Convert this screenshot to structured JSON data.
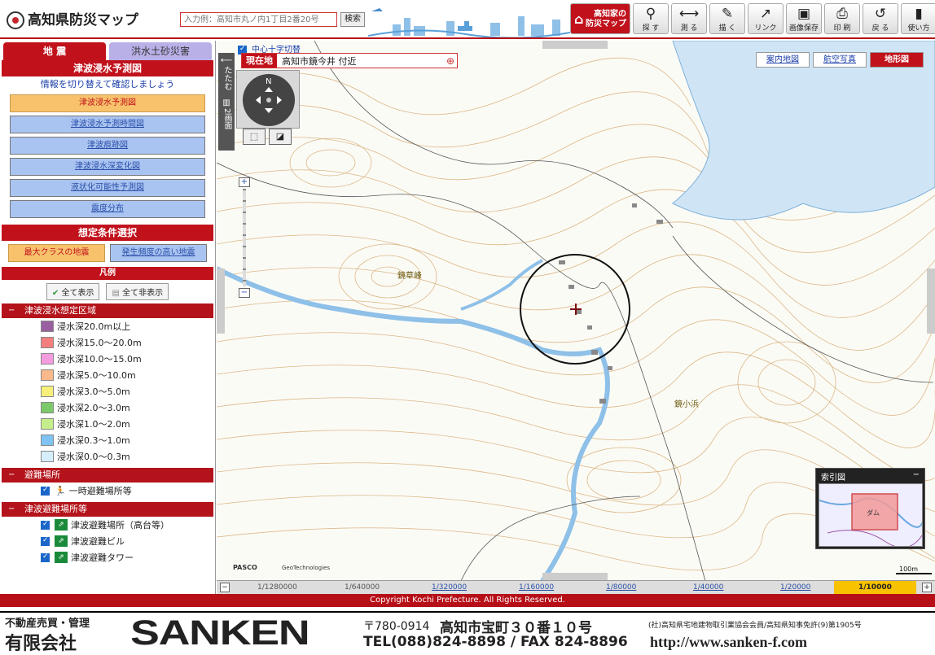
{
  "header": {
    "title": "高知県防災マップ",
    "search_placeholder": "入力例：高知市丸ノ内1丁目2番20号",
    "search_button": "検索"
  },
  "toolbar": [
    {
      "label": "高知家の\n防災マップ",
      "icon": "home-icon"
    },
    {
      "label": "探 す",
      "icon": "magnifier-icon"
    },
    {
      "label": "測 る",
      "icon": "ruler-icon"
    },
    {
      "label": "描 く",
      "icon": "paint-icon"
    },
    {
      "label": "リンク",
      "icon": "link-icon"
    },
    {
      "label": "画像保存",
      "icon": "save-icon"
    },
    {
      "label": "印 刷",
      "icon": "printer-icon"
    },
    {
      "label": "戻 る",
      "icon": "undo-icon"
    },
    {
      "label": "使い方",
      "icon": "help-icon"
    }
  ],
  "sidebar": {
    "tabs": [
      "地 震",
      "洪水土砂災害"
    ],
    "section_title": "津波浸水予測図",
    "message": "情報を切り替えて確認しましょう",
    "map_buttons": [
      "津波浸水予測図",
      "津波浸水予測時間図",
      "津波痕跡図",
      "津波浸水深変化図",
      "液状化可能性予測図",
      "震度分布"
    ],
    "condition_title": "想定条件選択",
    "condition_buttons": [
      "最大クラスの地震",
      "発生頻度の高い地震"
    ],
    "legend_title": "凡例",
    "show_all": "全て表示",
    "hide_all": "全て非表示",
    "cat1": "津波浸水想定区域",
    "depths": [
      {
        "label": "浸水深20.0m以上",
        "color": "#9a5fa0"
      },
      {
        "label": "浸水深15.0～20.0m",
        "color": "#f47e7e"
      },
      {
        "label": "浸水深10.0～15.0m",
        "color": "#f59be0"
      },
      {
        "label": "浸水深5.0～10.0m",
        "color": "#f9b98a"
      },
      {
        "label": "浸水深3.0～5.0m",
        "color": "#f6f07a"
      },
      {
        "label": "浸水深2.0～3.0m",
        "color": "#7cc96a"
      },
      {
        "label": "浸水深1.0～2.0m",
        "color": "#c7ee8c"
      },
      {
        "label": "浸水深0.3～1.0m",
        "color": "#7fc3f2"
      },
      {
        "label": "浸水深0.0～0.3m",
        "color": "#d6eefc"
      }
    ],
    "cat2": "避難場所",
    "shelter1": "一時避難場所等",
    "cat3": "津波避難場所等",
    "shelters": [
      "津波避難場所（高台等）",
      "津波避難ビル",
      "津波避難タワー"
    ]
  },
  "map": {
    "crosshair_toggle": "中心十字切替",
    "location_tag": "現在地",
    "location": "高知市鏡今井 付近",
    "fold": "たたむ",
    "split": "2画面",
    "north": "N",
    "tabs": [
      "案内地図",
      "航空写真",
      "地形図"
    ],
    "active_tab": "地形図",
    "place1": "鏡草峰",
    "place2": "鏡小浜",
    "dam": "ダム",
    "brand1": "PASCO",
    "brand2": "GeoTechnologies",
    "minimap_title": "索引図",
    "scale_text": "100m",
    "scales": [
      "1/1280000",
      "1/640000",
      "1/320000",
      "1/160000",
      "1/80000",
      "1/40000",
      "1/20000",
      "1/10000"
    ],
    "active_scale": "1/10000"
  },
  "copyright": "Copyright Kochi Prefecture. All Rights Reserved.",
  "ad": {
    "line1": "不動産売買・管理",
    "company": "有限会社",
    "brand": "SANKEN",
    "postal": "〒780-0914",
    "address": "高知市宝町３０番１０号",
    "assoc": "(社)高知県宅地建物取引業協会会員/高知県知事免許(9)第1905号",
    "tel": "TEL(088)824-8898 / FAX 824-8896",
    "url": "http://www.sanken-f.com"
  }
}
